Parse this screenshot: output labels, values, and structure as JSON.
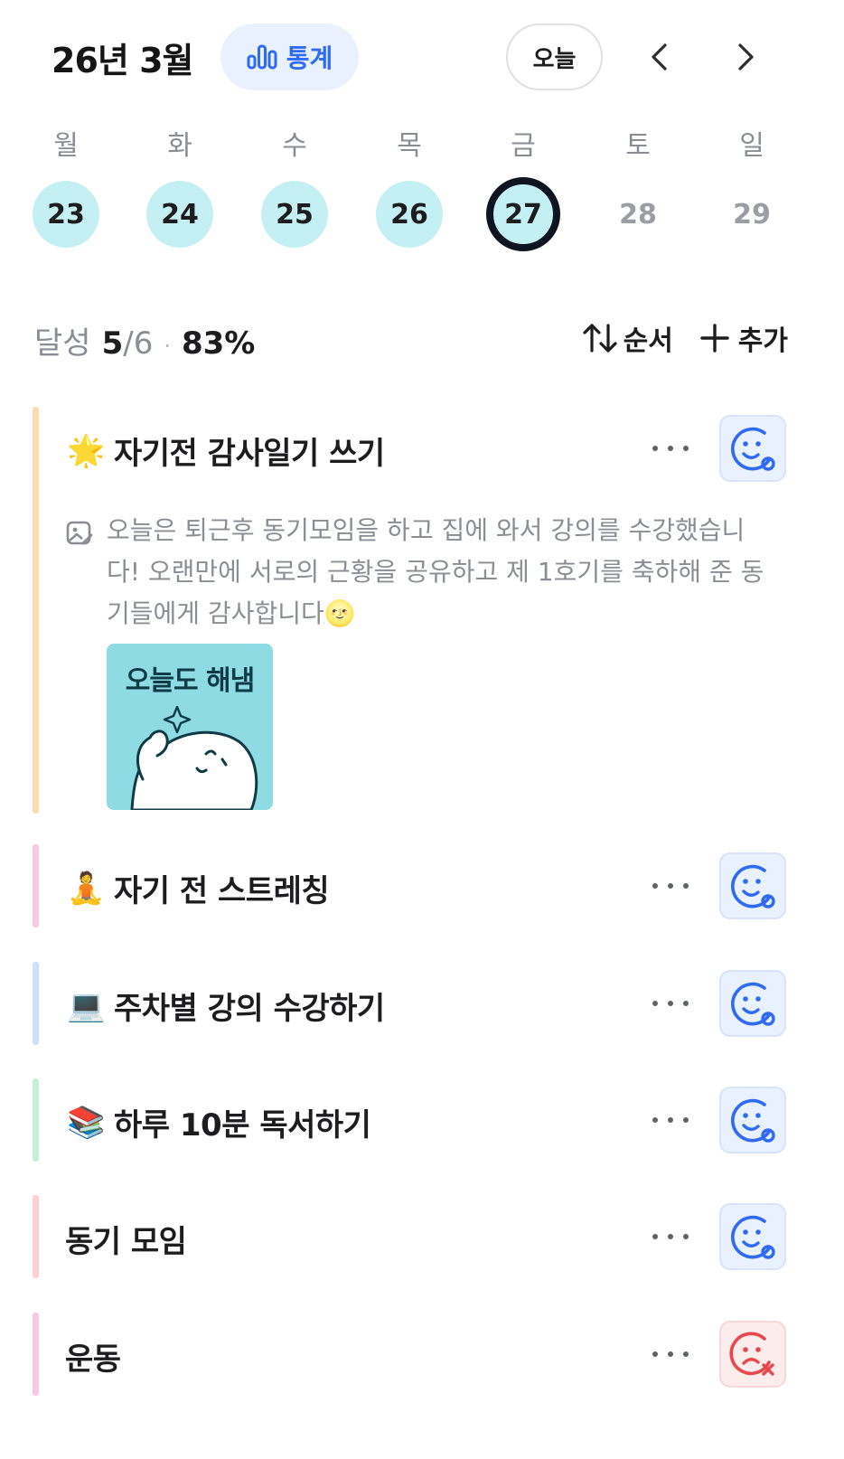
{
  "header": {
    "month_title": "26년 3월",
    "stats_label": "통계",
    "today_label": "오늘"
  },
  "week": {
    "days": [
      {
        "dow": "월",
        "date": "23",
        "status": "done"
      },
      {
        "dow": "화",
        "date": "24",
        "status": "done"
      },
      {
        "dow": "수",
        "date": "25",
        "status": "done"
      },
      {
        "dow": "목",
        "date": "26",
        "status": "done"
      },
      {
        "dow": "금",
        "date": "27",
        "status": "selected"
      },
      {
        "dow": "토",
        "date": "28",
        "status": "future"
      },
      {
        "dow": "일",
        "date": "29",
        "status": "future"
      }
    ]
  },
  "summary": {
    "label": "달성",
    "done": "5",
    "total": "/6",
    "separator": "·",
    "percent": "83%",
    "order_label": "순서",
    "add_label": "추가"
  },
  "habits": [
    {
      "title": "자기전 감사일기 쓰기",
      "emoji": "🌟",
      "bar_color": "#fbdcb3",
      "status": "ok",
      "note": "오늘은 퇴근후 동기모임을 하고 집에 와서 강의를 수강했습니다! 오랜만에 서로의 근황을 공유하고 제 1호기를 축하해 준 동기들에게 감사합니다🌝",
      "note_image_text": "오늘도 해냄"
    },
    {
      "title": "자기 전 스트레칭",
      "emoji": "🧘",
      "bar_color": "#f9c8e2",
      "status": "ok"
    },
    {
      "title": "주차별 강의 수강하기",
      "emoji": "💻",
      "bar_color": "#cfe0fb",
      "status": "ok"
    },
    {
      "title": "하루 10분 독서하기",
      "emoji": "📚",
      "bar_color": "#c6efd8",
      "status": "ok"
    },
    {
      "title": "동기 모임",
      "emoji": "",
      "bar_color": "#fbd0cf",
      "status": "ok"
    },
    {
      "title": "운동",
      "emoji": "",
      "bar_color": "#f9c8e2",
      "status": "fail"
    }
  ],
  "colors": {
    "accent": "#2f6bf2",
    "done_day": "#c4f0f4",
    "fail": "#e5484d"
  },
  "icons": {
    "stats": "bar-chart-icon",
    "prev": "chevron-left-icon",
    "next": "chevron-right-icon",
    "order": "sort-arrows-icon",
    "add": "plus-icon",
    "more": "more-dots-icon",
    "mood_ok": "smile-face-icon",
    "mood_fail": "sad-face-x-icon",
    "note": "image-note-icon"
  }
}
